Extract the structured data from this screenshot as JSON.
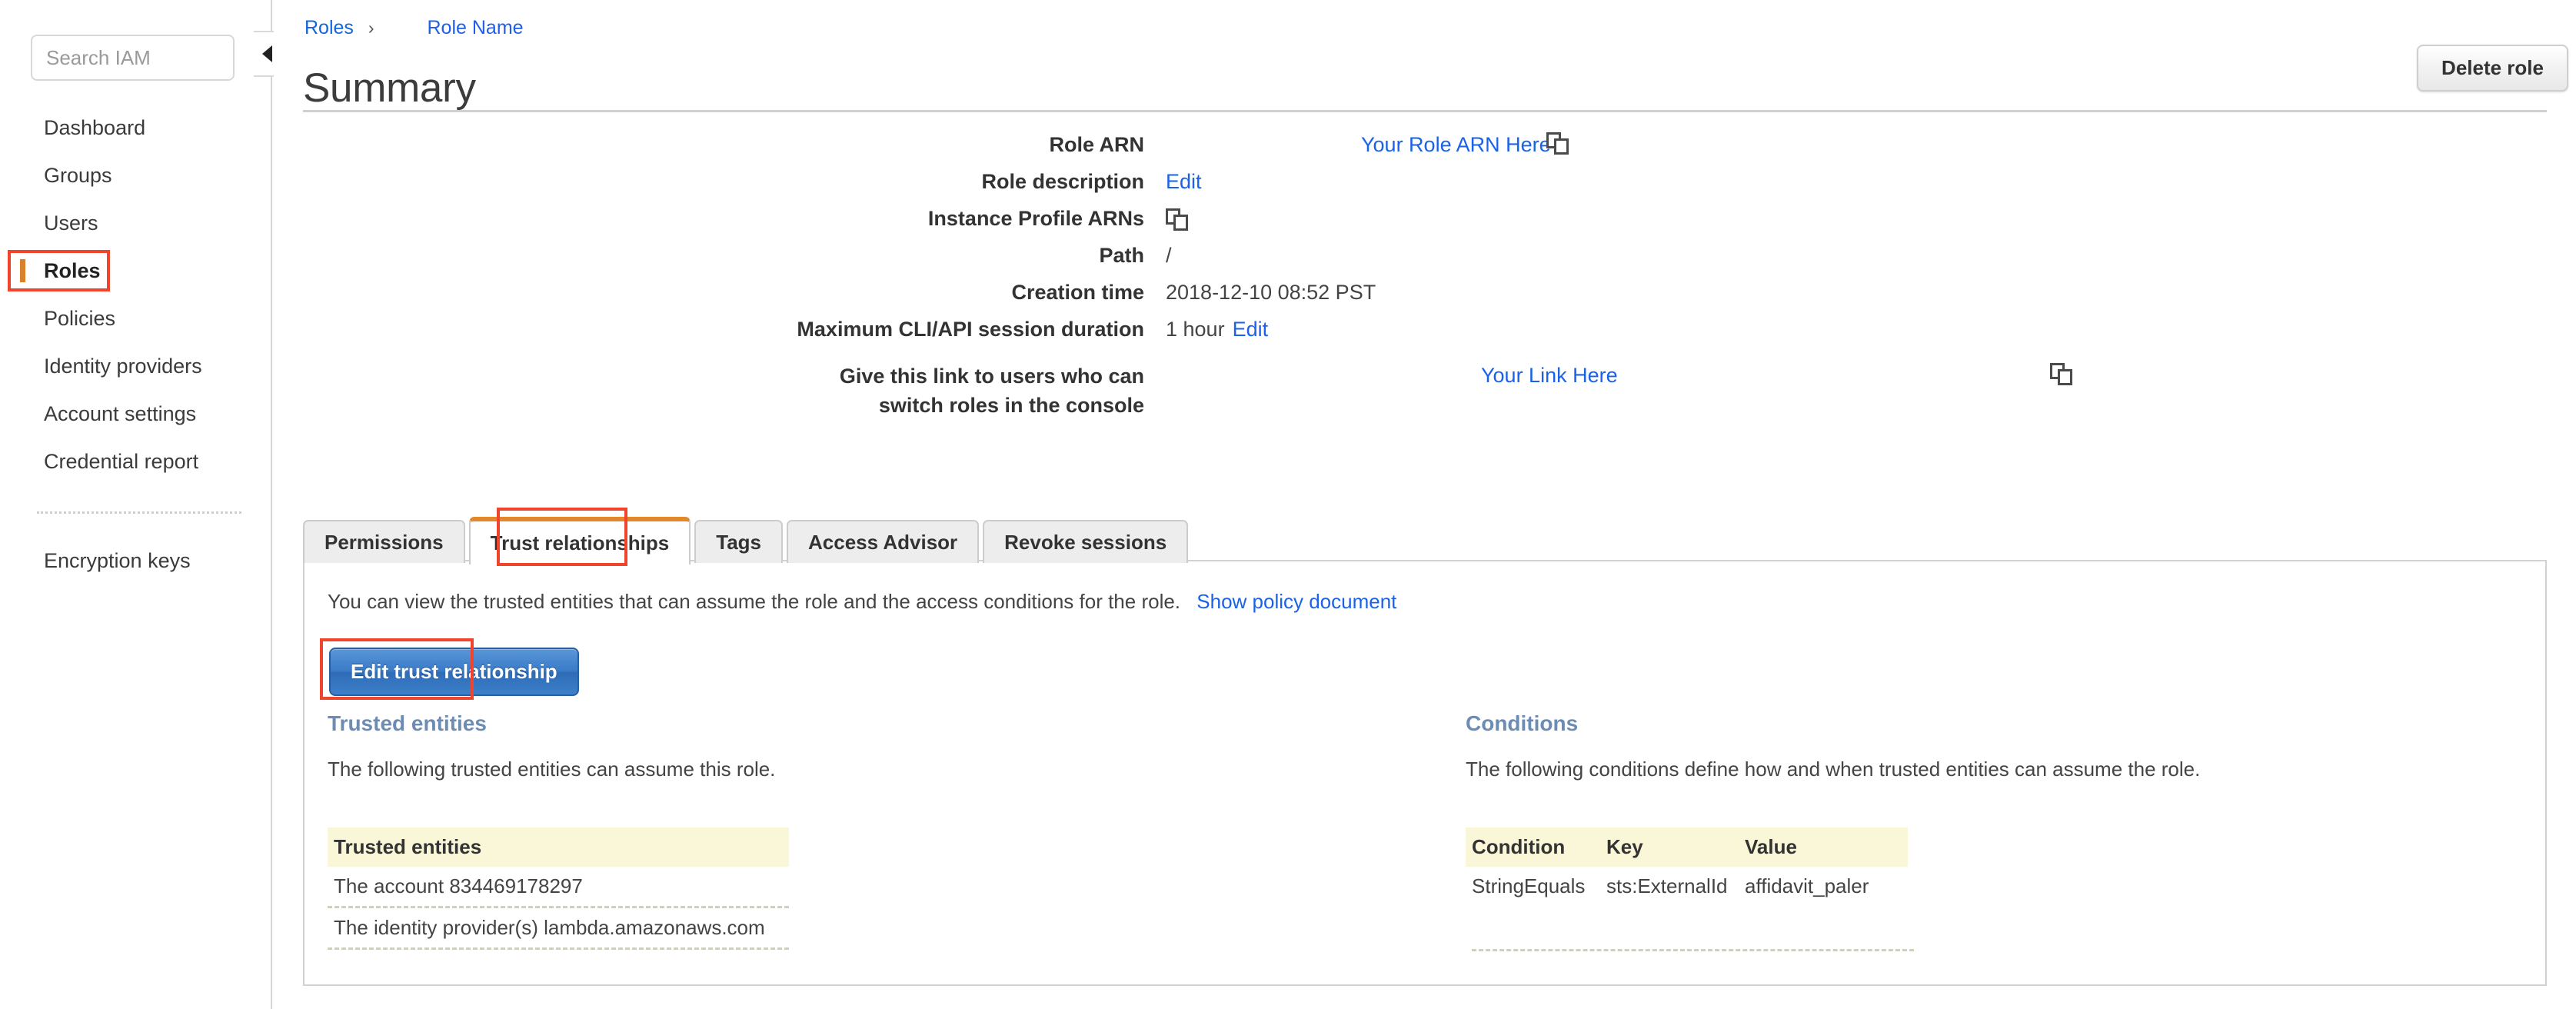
{
  "sidebar": {
    "search": {
      "placeholder": "Search IAM",
      "value": ""
    },
    "items": [
      {
        "label": "Dashboard",
        "active": false
      },
      {
        "label": "Groups",
        "active": false
      },
      {
        "label": "Users",
        "active": false
      },
      {
        "label": "Roles",
        "active": true
      },
      {
        "label": "Policies",
        "active": false
      },
      {
        "label": "Identity providers",
        "active": false
      },
      {
        "label": "Account settings",
        "active": false
      },
      {
        "label": "Credential report",
        "active": false
      }
    ],
    "items_after_divider": [
      {
        "label": "Encryption keys",
        "active": false
      }
    ],
    "collapse_icon": "chevron-left-icon"
  },
  "header": {
    "breadcrumb_root": "Roles",
    "breadcrumb_separator": "›",
    "breadcrumb_current": "Role Name",
    "title": "Summary",
    "delete_button": "Delete role"
  },
  "summary": {
    "rows": [
      {
        "label": "Role ARN",
        "value": "Your Role ARN Here",
        "kind": "centered-link",
        "copy": true
      },
      {
        "label": "Role description",
        "value": "Edit",
        "kind": "link",
        "copy": false
      },
      {
        "label": "Instance Profile ARNs",
        "value": "",
        "kind": "copy-only",
        "copy": true
      },
      {
        "label": "Path",
        "value": "/",
        "kind": "text",
        "copy": false
      },
      {
        "label": "Creation time",
        "value": "2018-12-10 08:52 PST",
        "kind": "text",
        "copy": false
      },
      {
        "label": "Maximum CLI/API session duration",
        "value": "1 hour",
        "link": "Edit",
        "kind": "text-link",
        "copy": false
      },
      {
        "label": "Give this link to users who can switch roles in the console",
        "value": "Your Link Here",
        "kind": "centered-link",
        "copy": true
      }
    ],
    "copy_icon": "copy-icon"
  },
  "tabs": [
    {
      "label": "Permissions",
      "active": false
    },
    {
      "label": "Trust relationships",
      "active": true
    },
    {
      "label": "Tags",
      "active": false
    },
    {
      "label": "Access Advisor",
      "active": false
    },
    {
      "label": "Revoke sessions",
      "active": false
    }
  ],
  "panel": {
    "intro_text": "You can view the trusted entities that can assume the role and the access conditions for the role.",
    "intro_link": "Show policy document",
    "edit_button": "Edit trust relationship",
    "trusted_entities": {
      "heading": "Trusted entities",
      "description": "The following trusted entities can assume this role.",
      "table_header": "Trusted entities",
      "rows": [
        "The account 834469178297",
        "The identity provider(s) lambda.amazonaws.com"
      ]
    },
    "conditions": {
      "heading": "Conditions",
      "description": "The following conditions define how and when trusted entities can assume the role.",
      "columns": [
        "Condition",
        "Key",
        "Value"
      ],
      "rows": [
        [
          "StringEquals",
          "sts:ExternalId",
          "affidavit_paler"
        ]
      ]
    }
  },
  "annotations": {
    "highlight_color": "#f0442c",
    "accent_orange": "#d9822b",
    "link_blue": "#1a62e8",
    "heading_blue": "#6d8cb4",
    "table_header_bg": "#faf6d8"
  }
}
